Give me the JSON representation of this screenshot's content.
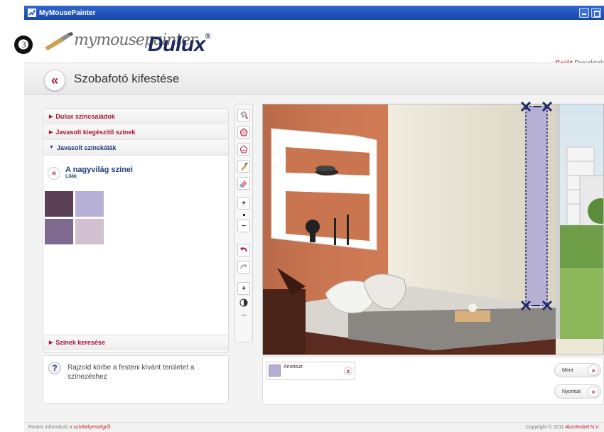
{
  "window": {
    "title": "MyMousePainter"
  },
  "header": {
    "step_number": "❸",
    "logo_script": "mymousepainter",
    "logo_brand": "Dulux",
    "logo_reg": "®",
    "projects_bold": "Saját",
    "projects_rest": " Projektek"
  },
  "page": {
    "back_glyph": "«",
    "title": "Szobafotó kifestése"
  },
  "left_panel": {
    "accordion": [
      {
        "label": "Dulux színcsaládok",
        "state": "collapsed"
      },
      {
        "label": "Javasolt kiegészítő színek",
        "state": "collapsed"
      },
      {
        "label": "Javasolt színskálák",
        "state": "expanded"
      }
    ],
    "palette": {
      "title": "A nagyvilág színei",
      "subtitle": "Lilák",
      "back_glyph": "«",
      "swatches": [
        "#5b3f55",
        "#b7b1d7",
        "#7e6a8e",
        "#d2c1cf"
      ]
    },
    "search_label": "Színek keresése"
  },
  "help": {
    "icon": "?",
    "text": "Rajzold körbe a festeni kívánt területet a színezéshez"
  },
  "toolbar": {
    "tools": [
      "fill-tool-icon",
      "polygon-tool-icon",
      "polygon-erase-icon",
      "brush-icon",
      "eraser-icon",
      "brush-size-plus",
      "brush-size-dot",
      "brush-size-minus",
      "undo-icon",
      "redo-icon",
      "zoom-plus",
      "contrast-icon",
      "zoom-minus"
    ],
    "plus": "+",
    "minus": "−"
  },
  "colors_bar": {
    "chip_label": "Ametiszt",
    "chip_color": "#b4aed6",
    "remove_glyph": "x",
    "buttons": [
      {
        "label": "Ment",
        "glyph": "»"
      },
      {
        "label": "Nyomtat",
        "glyph": "»"
      }
    ]
  },
  "footer": {
    "left_prefix": "Fontos információ a ",
    "left_link": "színhelyességről",
    "right_prefix": "Copyright © 2011 ",
    "right_link": "AkzoNobel N.V."
  },
  "colors": {
    "accent": "#b3163a",
    "navy": "#243b7c",
    "titlebar": "#2f67cf",
    "selection": "#b4aed6"
  }
}
